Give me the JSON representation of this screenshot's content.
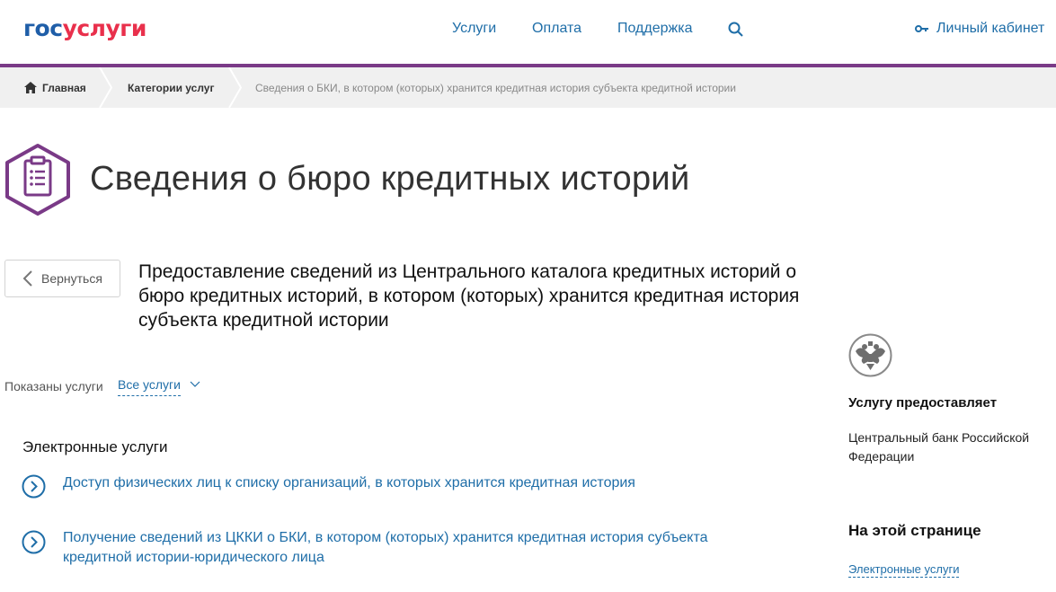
{
  "header": {
    "logo_part1": "гос",
    "logo_part2": "услуги",
    "nav": [
      {
        "label": "Услуги"
      },
      {
        "label": "Оплата"
      },
      {
        "label": "Поддержка"
      }
    ],
    "search_icon": "search-icon",
    "cabinet_label": "Личный кабинет",
    "accent_color": "#7a3a87"
  },
  "breadcrumbs": [
    {
      "label": "Главная"
    },
    {
      "label": "Категории услуг"
    },
    {
      "label": "Сведения о БКИ, в котором (которых) хранится кредитная история субъекта кредитной истории"
    }
  ],
  "page": {
    "title": "Сведения о бюро кредитных историй",
    "back_label": "Вернуться",
    "subtitle": "Предоставление сведений из Центрального каталога кредитных историй о бюро кредитных историй, в котором (которых) хранится кредитная история субъекта кредитной истории"
  },
  "filter": {
    "label": "Показаны услуги",
    "value": "Все услуги"
  },
  "services": {
    "section_title": "Электронные услуги",
    "items": [
      {
        "label": "Доступ физических лиц к списку организаций, в которых хранится кредитная история"
      },
      {
        "label": "Получение сведений из ЦККИ о БКИ, в котором (которых) хранится кредитная история субъекта кредитной истории-юридического лица"
      }
    ]
  },
  "sidebar": {
    "provider_heading": "Услугу предоставляет",
    "provider_name": "Центральный банк Российской Федерации",
    "on_page_heading": "На этой странице",
    "on_page_link": "Электронные услуги"
  }
}
